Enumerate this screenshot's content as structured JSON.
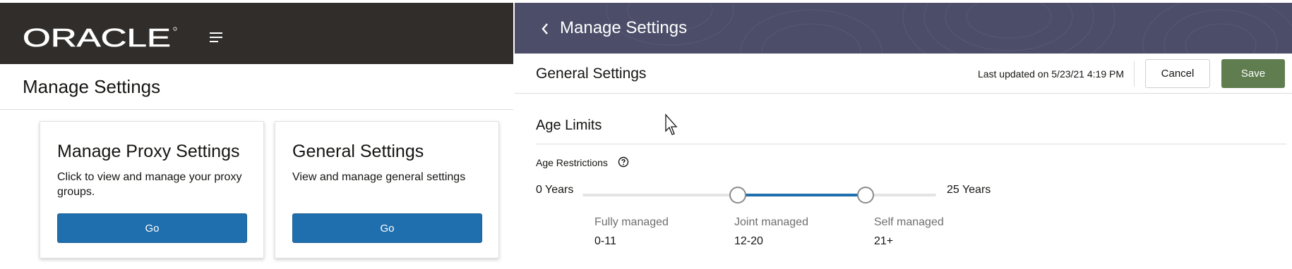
{
  "left": {
    "brand": "ORACLE",
    "header_icon": "hamburger-menu-icon",
    "page_title": "Manage Settings",
    "cards": [
      {
        "title": "Manage Proxy Settings",
        "description": "Click to view and manage your proxy groups.",
        "button_label": "Go"
      },
      {
        "title": "General Settings",
        "description": "View and manage general settings",
        "button_label": "Go"
      }
    ]
  },
  "right": {
    "header": {
      "title": "Manage Settings",
      "back_icon": "chevron-left-icon"
    },
    "subheader": {
      "title": "General Settings",
      "last_updated": "Last updated on 5/23/21 4:19 PM",
      "cancel_label": "Cancel",
      "save_label": "Save"
    },
    "age_limits": {
      "section_title": "Age Limits",
      "restrictions_label": "Age Restrictions",
      "help_icon": "question-circle-icon",
      "slider": {
        "min_label": "0 Years",
        "max_label": "25 Years",
        "min": 0,
        "max": 25,
        "low": 11,
        "high": 20
      },
      "ranges": [
        {
          "name": "Fully managed",
          "value": "0-11"
        },
        {
          "name": "Joint managed",
          "value": "12-20"
        },
        {
          "name": "Self managed",
          "value": "21+"
        }
      ]
    }
  },
  "colors": {
    "oracle_header": "#312d2a",
    "manage_header": "#4c4e69",
    "primary_button": "#1f6fae",
    "save_button": "#5f7d4f"
  }
}
